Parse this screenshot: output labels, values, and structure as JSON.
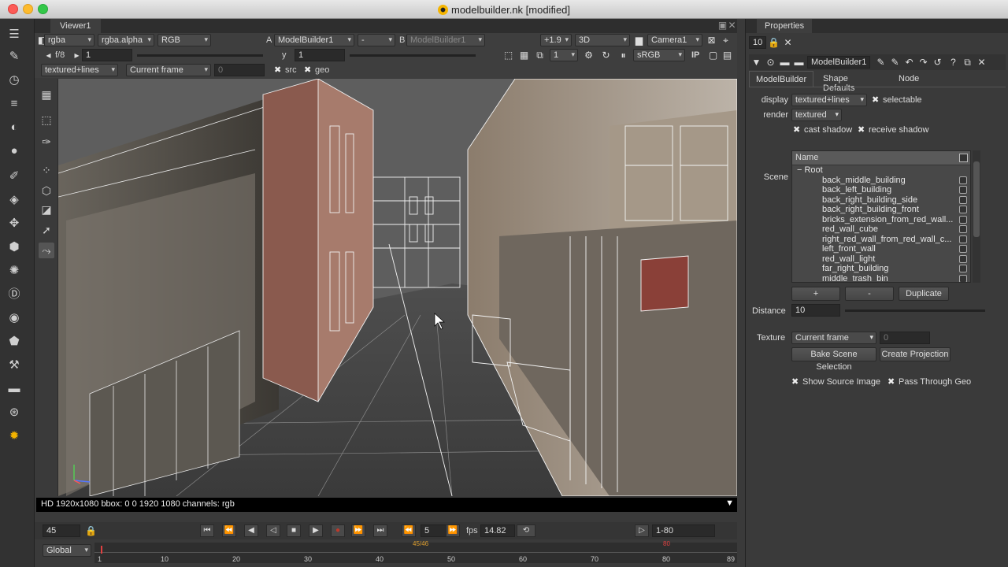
{
  "window": {
    "title": "modelbuilder.nk [modified]"
  },
  "viewer": {
    "tab": "Viewer1",
    "row1": {
      "channels": "rgba",
      "alpha": "rgba.alpha",
      "colorspace": "RGB",
      "a_label": "A",
      "a_input": "ModelBuilder1",
      "wipe": "-",
      "b_label": "B",
      "b_input": "ModelBuilder1",
      "zoom": "+1.9",
      "view_mode": "3D",
      "camera": "Camera1"
    },
    "row2": {
      "fstop": "f/8",
      "gain": "1",
      "y_label": "y",
      "gamma": "1",
      "proxy": "1",
      "lut": "sRGB",
      "ip": "IP"
    },
    "row3": {
      "display": "textured+lines",
      "frame_mode": "Current frame",
      "frame_value": "0",
      "src": "src",
      "geo": "geo"
    },
    "info": "HD 1920x1080 bbox: 0 0 1920 1080 channels: rgb",
    "timeline": {
      "frame": "45",
      "step": "5",
      "fps_label": "fps",
      "fps": "14.82",
      "range": "1-80",
      "global": "Global"
    },
    "ruler": {
      "ticks": [
        "1",
        "10",
        "20",
        "30",
        "40",
        "50",
        "60",
        "70",
        "80",
        "89"
      ],
      "marker_left": "45/46",
      "marker_right": "80"
    }
  },
  "properties": {
    "tab": "Properties",
    "count": "10",
    "node_name": "ModelBuilder1",
    "subtabs": [
      "ModelBuilder",
      "Shape Defaults",
      "Node"
    ],
    "display_label": "display",
    "display_value": "textured+lines",
    "selectable_label": "selectable",
    "render_label": "render",
    "render_value": "textured",
    "cast_shadow": "cast shadow",
    "receive_shadow": "receive shadow",
    "scene_label": "Scene",
    "scene_header": "Name",
    "root": "Root",
    "scene_items": [
      "back_middle_building",
      "back_left_building",
      "back_right_building_side",
      "back_right_building_front",
      "bricks_extension_from_red_wall...",
      "red_wall_cube",
      "right_red_wall_from_red_wall_c...",
      "left_front_wall",
      "red_wall_light",
      "far_right_building",
      "middle_trash_bin"
    ],
    "add_btn": "+",
    "remove_btn": "-",
    "duplicate_btn": "Duplicate",
    "distance_label": "Distance",
    "distance_value": "10",
    "texture_label": "Texture",
    "texture_value": "Current frame",
    "texture_frame": "0",
    "bake_btn": "Bake Scene Selection",
    "create_projection_btn": "Create Projection",
    "show_source": "Show Source Image",
    "pass_through": "Pass Through Geo"
  },
  "colors": {
    "accent": "#f4b400",
    "background": "#3a3a3a",
    "record": "#c0392b"
  }
}
